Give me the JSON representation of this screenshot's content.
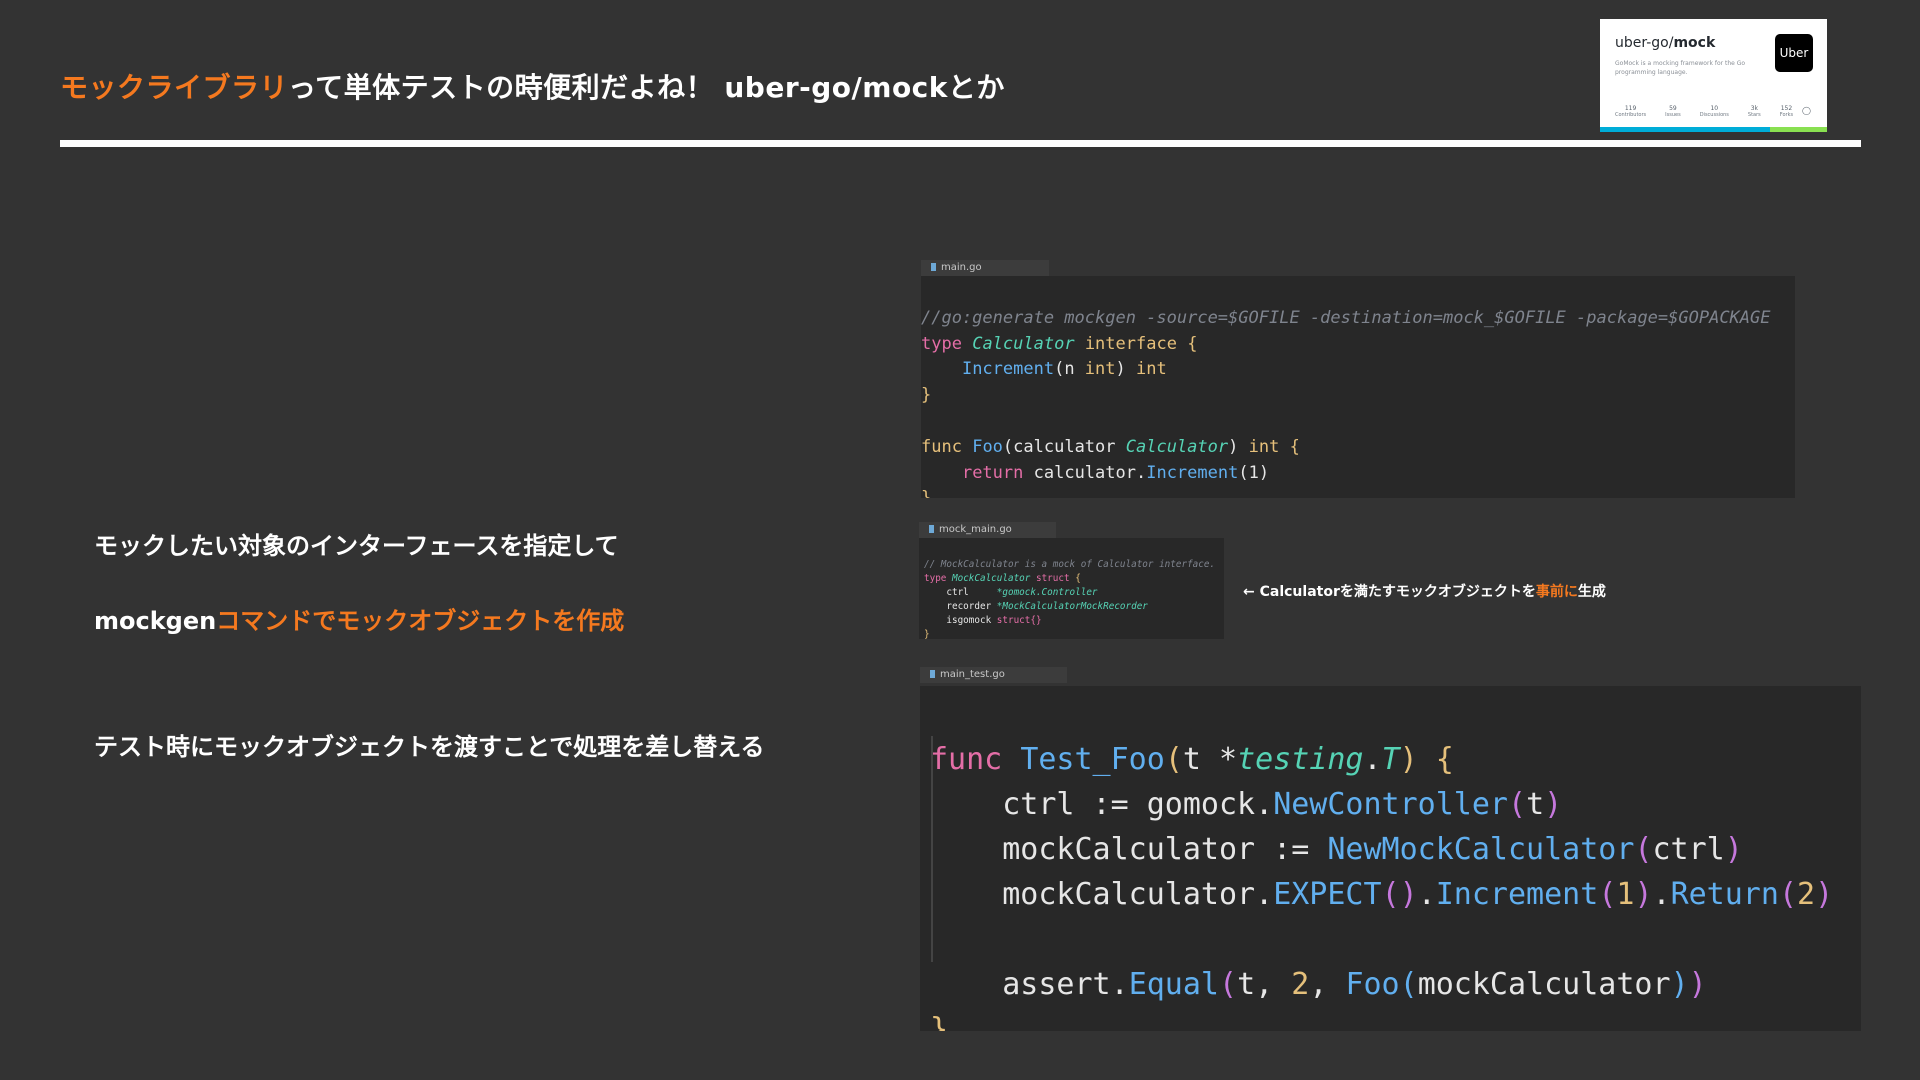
{
  "slide": {
    "title_highlight": "モックライブラリ",
    "title_rest": "って単体テストの時便利だよね！ uber-go/mockとか"
  },
  "github_card": {
    "repo_owner": "uber-go/",
    "repo_name": "mock",
    "description": "GoMock is a mocking framework for the Go programming language.",
    "logo_text": "Uber",
    "stats": [
      {
        "value": "119",
        "label": "Contributors"
      },
      {
        "value": "59",
        "label": "Issues"
      },
      {
        "value": "10",
        "label": "Discussions"
      },
      {
        "value": "3k",
        "label": "Stars"
      },
      {
        "value": "152",
        "label": "Forks"
      }
    ],
    "language_colors": [
      "#00ADD8",
      "#00ADD8",
      "#89e051",
      "#89e051"
    ]
  },
  "bullets": {
    "b1": "モックしたい対象のインターフェースを指定して",
    "b2_plain": "mockgen",
    "b2_highlight": "コマンドでモックオブジェクトを作成",
    "b3": "テスト時にモックオブジェクトを渡すことで処理を差し替える"
  },
  "files": {
    "main": "main.go",
    "mock": "mock_main.go",
    "test": "main_test.go"
  },
  "code_main": {
    "generate": "//go:generate mockgen -source=$GOFILE -destination=mock_$GOFILE -package=$GOPACKAGE",
    "type_kw": "type",
    "iface_name": "Calculator",
    "iface_kw": "interface",
    "open": "{",
    "method": "Increment",
    "params_open": "(n ",
    "int1": "int",
    "params_close": ")",
    "int2": "int",
    "close1": "}",
    "func_kw": "func",
    "func_name": "Foo",
    "args_open": "(calculator ",
    "arg_type": "Calculator",
    "args_close": ")",
    "ret": "int",
    "open2": "{",
    "return_kw": "return",
    "call_obj": "calculator.",
    "call_method": "Increment",
    "call_args": "(1)",
    "close2": "}"
  },
  "code_mock": {
    "comment": "// MockCalculator is a mock of Calculator interface.",
    "type_kw": "type",
    "struct_name": "MockCalculator",
    "struct_kw": "struct",
    "open": "{",
    "f1": "ctrl",
    "f1_type": "*gomock.Controller",
    "f2": "recorder",
    "f2_type": "*MockCalculatorMockRecorder",
    "f3": "isgomock",
    "f3_type": "struct{}",
    "close": "}"
  },
  "note": {
    "prefix": "← Calculatorを満たすモックオブジェクトを",
    "highlight": "事前に",
    "suffix": "生成"
  },
  "code_test": {
    "func_kw": "func",
    "func_name": "Test_Foo",
    "paren_open": "(",
    "param": "t ",
    "param_star": "*",
    "param_type": "testing",
    "dot": ".",
    "param_t": "T",
    "paren_close": ")",
    "open": "{",
    "l2_a": "ctrl := gomock.",
    "l2_f": "NewController",
    "l2_o": "(",
    "l2_arg": "t",
    "l2_c": ")",
    "l3_a": "mockCalculator := ",
    "l3_f": "NewMockCalculator",
    "l3_o": "(",
    "l3_arg": "ctrl",
    "l3_c": ")",
    "l4_a": "mockCalculator.",
    "l4_f1": "EXPECT",
    "l4_p1": "()",
    "l4_dot1": ".",
    "l4_f2": "Increment",
    "l4_p2o": "(",
    "l4_n1": "1",
    "l4_p2c": ")",
    "l4_dot2": ".",
    "l4_f3": "Return",
    "l4_p3o": "(",
    "l4_n2": "2",
    "l4_p3c": ")",
    "l5_a": "assert.",
    "l5_f": "Equal",
    "l5_o": "(",
    "l5_t": "t, ",
    "l5_n": "2",
    "l5_comma": ", ",
    "l5_f2": "Foo",
    "l5_o2": "(",
    "l5_arg": "mockCalculator",
    "l5_c2": ")",
    "l5_c": ")",
    "close": "}"
  }
}
